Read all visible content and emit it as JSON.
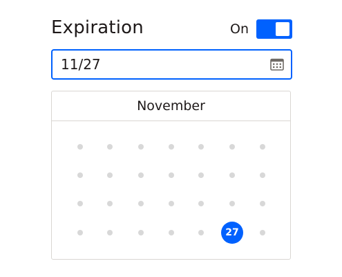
{
  "header": {
    "title": "Expiration",
    "toggle_label": "On",
    "toggle_state": "on"
  },
  "date_field": {
    "value": "11/27",
    "icon": "calendar-icon"
  },
  "calendar": {
    "month": "November",
    "rows": 4,
    "columns": 7,
    "selected_day": "27",
    "selected_row": 4,
    "selected_column": 6
  },
  "colors": {
    "accent": "#0061fe",
    "text": "#1e1919",
    "border": "#d9d6d2",
    "dot": "#d8d8d8"
  }
}
